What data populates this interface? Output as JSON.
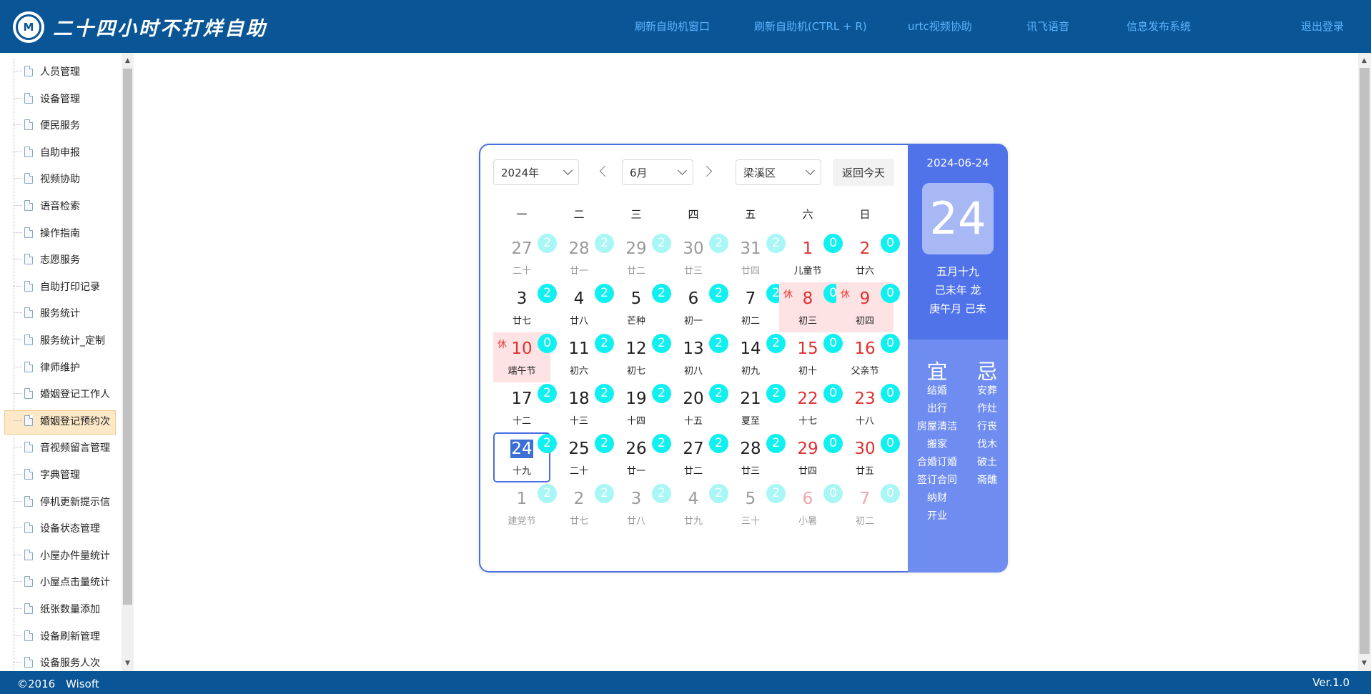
{
  "header": {
    "logo_text": "M",
    "title": "二十四小时不打烊自助",
    "nav": [
      "刷新自助机窗口",
      "刷新自助机(CTRL + R)",
      "urtc视频协助",
      "讯飞语音",
      "信息发布系统",
      "退出登录"
    ]
  },
  "sidebar": {
    "items": [
      "人员管理",
      "设备管理",
      "便民服务",
      "自助申报",
      "视频协助",
      "语音检索",
      "操作指南",
      "志愿服务",
      "自助打印记录",
      "服务统计",
      "服务统计_定制",
      "律师维护",
      "婚姻登记工作人",
      "婚姻登记预约次",
      "音视频留言管理",
      "字典管理",
      "停机更新提示信",
      "设备状态管理",
      "小屋办件量统计",
      "小屋点击量统计",
      "纸张数量添加",
      "设备刷新管理",
      "设备服务人次"
    ],
    "selected_index": 13
  },
  "calendar": {
    "year_select": "2024年",
    "month_select": "6月",
    "district_select": "梁溪区",
    "today_button": "返回今天",
    "weekdays": [
      "一",
      "二",
      "三",
      "四",
      "五",
      "六",
      "日"
    ],
    "rest_mark": "休",
    "weeks": [
      [
        {
          "d": "27",
          "s": "二十",
          "b": "2",
          "other": true
        },
        {
          "d": "28",
          "s": "廿一",
          "b": "2",
          "other": true
        },
        {
          "d": "29",
          "s": "廿二",
          "b": "2",
          "other": true
        },
        {
          "d": "30",
          "s": "廿三",
          "b": "2",
          "other": true
        },
        {
          "d": "31",
          "s": "廿四",
          "b": "2",
          "other": true
        },
        {
          "d": "1",
          "s": "儿童节",
          "b": "0",
          "weekend": true
        },
        {
          "d": "2",
          "s": "廿六",
          "b": "0",
          "weekend": true
        }
      ],
      [
        {
          "d": "3",
          "s": "廿七",
          "b": "2"
        },
        {
          "d": "4",
          "s": "廿八",
          "b": "2"
        },
        {
          "d": "5",
          "s": "芒种",
          "b": "2"
        },
        {
          "d": "6",
          "s": "初一",
          "b": "2"
        },
        {
          "d": "7",
          "s": "初二",
          "b": "2"
        },
        {
          "d": "8",
          "s": "初三",
          "b": "0",
          "weekend": true,
          "holiday": true
        },
        {
          "d": "9",
          "s": "初四",
          "b": "0",
          "weekend": true,
          "holiday": true
        }
      ],
      [
        {
          "d": "10",
          "s": "端午节",
          "b": "0",
          "weekend": true,
          "holiday": true
        },
        {
          "d": "11",
          "s": "初六",
          "b": "2"
        },
        {
          "d": "12",
          "s": "初七",
          "b": "2"
        },
        {
          "d": "13",
          "s": "初八",
          "b": "2"
        },
        {
          "d": "14",
          "s": "初九",
          "b": "2"
        },
        {
          "d": "15",
          "s": "初十",
          "b": "0",
          "weekend": true
        },
        {
          "d": "16",
          "s": "父亲节",
          "b": "0",
          "weekend": true
        }
      ],
      [
        {
          "d": "17",
          "s": "十二",
          "b": "2"
        },
        {
          "d": "18",
          "s": "十三",
          "b": "2"
        },
        {
          "d": "19",
          "s": "十四",
          "b": "2"
        },
        {
          "d": "20",
          "s": "十五",
          "b": "2"
        },
        {
          "d": "21",
          "s": "夏至",
          "b": "2"
        },
        {
          "d": "22",
          "s": "十七",
          "b": "0",
          "weekend": true
        },
        {
          "d": "23",
          "s": "十八",
          "b": "0",
          "weekend": true
        }
      ],
      [
        {
          "d": "24",
          "s": "十九",
          "b": "2",
          "selected": true
        },
        {
          "d": "25",
          "s": "二十",
          "b": "2"
        },
        {
          "d": "26",
          "s": "廿一",
          "b": "2"
        },
        {
          "d": "27",
          "s": "廿二",
          "b": "2"
        },
        {
          "d": "28",
          "s": "廿三",
          "b": "2"
        },
        {
          "d": "29",
          "s": "廿四",
          "b": "0",
          "weekend": true
        },
        {
          "d": "30",
          "s": "廿五",
          "b": "0",
          "weekend": true
        }
      ],
      [
        {
          "d": "1",
          "s": "建党节",
          "b": "2",
          "other": true
        },
        {
          "d": "2",
          "s": "廿七",
          "b": "2",
          "other": true
        },
        {
          "d": "3",
          "s": "廿八",
          "b": "2",
          "other": true
        },
        {
          "d": "4",
          "s": "廿九",
          "b": "2",
          "other": true
        },
        {
          "d": "5",
          "s": "三十",
          "b": "2",
          "other": true
        },
        {
          "d": "6",
          "s": "小暑",
          "b": "0",
          "other": true,
          "weekend": true
        },
        {
          "d": "7",
          "s": "初二",
          "b": "0",
          "other": true,
          "weekend": true
        }
      ]
    ],
    "detail": {
      "date": "2024-06-24",
      "day": "24",
      "lunar": "五月十九",
      "year_gz": "己未年 龙",
      "month_gz": "庚午月 己未",
      "yi_title": "宜",
      "ji_title": "忌",
      "yi": [
        "结婚",
        "出行",
        "房屋清洁",
        "搬家",
        "合婚订婚",
        "签订合同",
        "纳财",
        "开业"
      ],
      "ji": [
        "安葬",
        "作灶",
        "行丧",
        "伐木",
        "破土",
        "斋醮"
      ]
    },
    "colors": {
      "accent": "#4a6ee0",
      "badge": "#11f0f0",
      "holiday_bg": "#fde3e3",
      "weekend_text": "#e03030"
    }
  },
  "footer": {
    "copyright": "©2016　Wisoft",
    "version": "Ver.1.0"
  }
}
